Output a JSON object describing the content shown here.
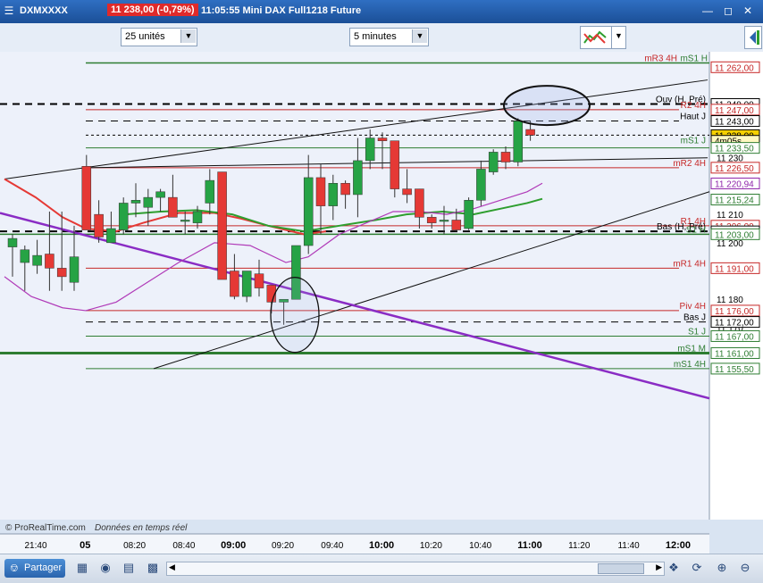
{
  "title_bar": {
    "symbol": "DXMXXXX",
    "price_badge": "11 238,00 (-0,79%)",
    "info": "11:05:55 Mini DAX Full1218 Future"
  },
  "toolbar": {
    "units_select": "25 unités",
    "timeframe_select": "5 minutes"
  },
  "chart": {
    "copyright": "© ProRealTime.com",
    "realtime_label": "Données en temps réel",
    "time_labels": [
      "21:40",
      "05",
      "08:20",
      "08:40",
      "09:00",
      "09:20",
      "09:40",
      "10:00",
      "10:20",
      "10:40",
      "11:00",
      "11:20",
      "11:40",
      "12:00"
    ],
    "bold_time_labels": [
      "05",
      "09:00",
      "10:00",
      "11:00",
      "12:00"
    ],
    "price_ticks": [
      "11 210",
      "11 200",
      "11 180",
      "11 170",
      "11 230"
    ],
    "price_tags": [
      {
        "label": "11 262,00",
        "color": "#c62828"
      },
      {
        "label": "11 249,00",
        "color": "#000000"
      },
      {
        "label": "11 247,00",
        "color": "#c62828"
      },
      {
        "label": "11 243,00",
        "color": "#000000"
      },
      {
        "label": "11 238,00",
        "color": "#000000"
      },
      {
        "label": "4m05s",
        "color": "#000000"
      },
      {
        "label": "11 233,50",
        "color": "#2e7d32"
      },
      {
        "label": "11 226,50",
        "color": "#c62828"
      },
      {
        "label": "11 220,94",
        "color": "#8e24aa"
      },
      {
        "label": "11 215,24",
        "color": "#2e7d32"
      },
      {
        "label": "11 206,00",
        "color": "#c62828"
      },
      {
        "label": "11 204,00",
        "color": "#000000"
      },
      {
        "label": "11 203,00",
        "color": "#2e7d32"
      },
      {
        "label": "11 191,00",
        "color": "#c62828"
      },
      {
        "label": "11 176,00",
        "color": "#c62828"
      },
      {
        "label": "11 172,00",
        "color": "#000000"
      },
      {
        "label": "11 167,00",
        "color": "#2e7d32"
      },
      {
        "label": "11 161,00",
        "color": "#2e7d32"
      },
      {
        "label": "11 155,50",
        "color": "#2e7d32"
      }
    ],
    "level_labels": [
      {
        "text": "mR3 4H",
        "color": "#c62828"
      },
      {
        "text": "mS1 H",
        "color": "#2e7d32"
      },
      {
        "text": "Ouv (H, Pré)",
        "color": "#000000"
      },
      {
        "text": "R2 4H",
        "color": "#c62828"
      },
      {
        "text": "Haut J",
        "color": "#000000"
      },
      {
        "text": "mS1 J",
        "color": "#2e7d32"
      },
      {
        "text": "mR2 4H",
        "color": "#c62828"
      },
      {
        "text": "R1 4H",
        "color": "#c62828"
      },
      {
        "text": "Bas (H, Pré)",
        "color": "#000000"
      },
      {
        "text": "S1 H",
        "color": "#2e7d32"
      },
      {
        "text": "mR1 4H",
        "color": "#c62828"
      },
      {
        "text": "Piv 4H",
        "color": "#c62828"
      },
      {
        "text": "Bas J",
        "color": "#000000"
      },
      {
        "text": "S1 J",
        "color": "#2e7d32"
      },
      {
        "text": "mS1 M",
        "color": "#2e7d32"
      },
      {
        "text": "mS1 4H",
        "color": "#2e7d32"
      }
    ],
    "candles": [
      {
        "o": 11198.5,
        "h": 11203,
        "l": 11188,
        "c": 11201.5
      },
      {
        "o": 11193,
        "h": 11199,
        "l": 11183,
        "c": 11197.5
      },
      {
        "o": 11192,
        "h": 11201,
        "l": 11189,
        "c": 11195.5
      },
      {
        "o": 11196,
        "h": 11211,
        "l": 11183,
        "c": 11191
      },
      {
        "o": 11191,
        "h": 11211,
        "l": 11183,
        "c": 11188
      },
      {
        "o": 11186,
        "h": 11206,
        "l": 11183,
        "c": 11195
      },
      {
        "o": 11227,
        "h": 11231,
        "l": 11206,
        "c": 11204.5
      },
      {
        "o": 11210,
        "h": 11215,
        "l": 11200,
        "c": 11202
      },
      {
        "o": 11200,
        "h": 11211,
        "l": 11200,
        "c": 11205
      },
      {
        "o": 11204.5,
        "h": 11216,
        "l": 11203,
        "c": 11214
      },
      {
        "o": 11214,
        "h": 11221,
        "l": 11209,
        "c": 11215
      },
      {
        "o": 11212.5,
        "h": 11219,
        "l": 11206,
        "c": 11216
      },
      {
        "o": 11216,
        "h": 11219,
        "l": 11211,
        "c": 11218
      },
      {
        "o": 11216,
        "h": 11224,
        "l": 11209,
        "c": 11209
      },
      {
        "o": 11208,
        "h": 11211,
        "l": 11203,
        "c": 11208
      },
      {
        "o": 11207,
        "h": 11213,
        "l": 11205,
        "c": 11211
      },
      {
        "o": 11214,
        "h": 11226,
        "l": 11210,
        "c": 11222
      },
      {
        "o": 11225,
        "h": 11225,
        "l": 11189,
        "c": 11187
      },
      {
        "o": 11190,
        "h": 11196,
        "l": 11180,
        "c": 11181
      },
      {
        "o": 11181,
        "h": 11190,
        "l": 11179,
        "c": 11190
      },
      {
        "o": 11189,
        "h": 11194,
        "l": 11181,
        "c": 11184
      },
      {
        "o": 11185,
        "h": 11185,
        "l": 11175,
        "c": 11179
      },
      {
        "o": 11179,
        "h": 11180,
        "l": 11171,
        "c": 11180
      },
      {
        "o": 11180,
        "h": 11187,
        "l": 11180,
        "c": 11199
      },
      {
        "o": 11199,
        "h": 11231,
        "l": 11196,
        "c": 11223
      },
      {
        "o": 11223,
        "h": 11228,
        "l": 11203,
        "c": 11213
      },
      {
        "o": 11213,
        "h": 11224,
        "l": 11208,
        "c": 11221
      },
      {
        "o": 11221,
        "h": 11222,
        "l": 11212,
        "c": 11217
      },
      {
        "o": 11217,
        "h": 11237,
        "l": 11209,
        "c": 11229
      },
      {
        "o": 11229,
        "h": 11240,
        "l": 11226,
        "c": 11237
      },
      {
        "o": 11237,
        "h": 11239,
        "l": 11226,
        "c": 11236
      },
      {
        "o": 11236,
        "h": 11236,
        "l": 11216,
        "c": 11219
      },
      {
        "o": 11219,
        "h": 11226,
        "l": 11214,
        "c": 11217
      },
      {
        "o": 11219,
        "h": 11219,
        "l": 11205,
        "c": 11209
      },
      {
        "o": 11209,
        "h": 11210,
        "l": 11205,
        "c": 11207
      },
      {
        "o": 11208,
        "h": 11213,
        "l": 11203,
        "c": 11208
      },
      {
        "o": 11208,
        "h": 11212,
        "l": 11204,
        "c": 11204.5
      },
      {
        "o": 11205,
        "h": 11216,
        "l": 11204.5,
        "c": 11215
      },
      {
        "o": 11215,
        "h": 11229,
        "l": 11213,
        "c": 11226
      },
      {
        "o": 11225,
        "h": 11233,
        "l": 11224,
        "c": 11232
      },
      {
        "o": 11232,
        "h": 11234,
        "l": 11226,
        "c": 11228.5
      },
      {
        "o": 11228.5,
        "h": 11244,
        "l": 11227,
        "c": 11243
      },
      {
        "o": 11240,
        "h": 11243,
        "l": 11236,
        "c": 11238
      }
    ]
  },
  "bottom_bar": {
    "share_label": "Partager"
  },
  "colors": {
    "bull": "#26a345",
    "bear": "#e53935",
    "ma_red": "#e53935",
    "ma_green": "#2e9e2e",
    "ma_purple": "#b03ab8",
    "trend_purple": "#8a2cc4",
    "background": "#edf1fa"
  }
}
